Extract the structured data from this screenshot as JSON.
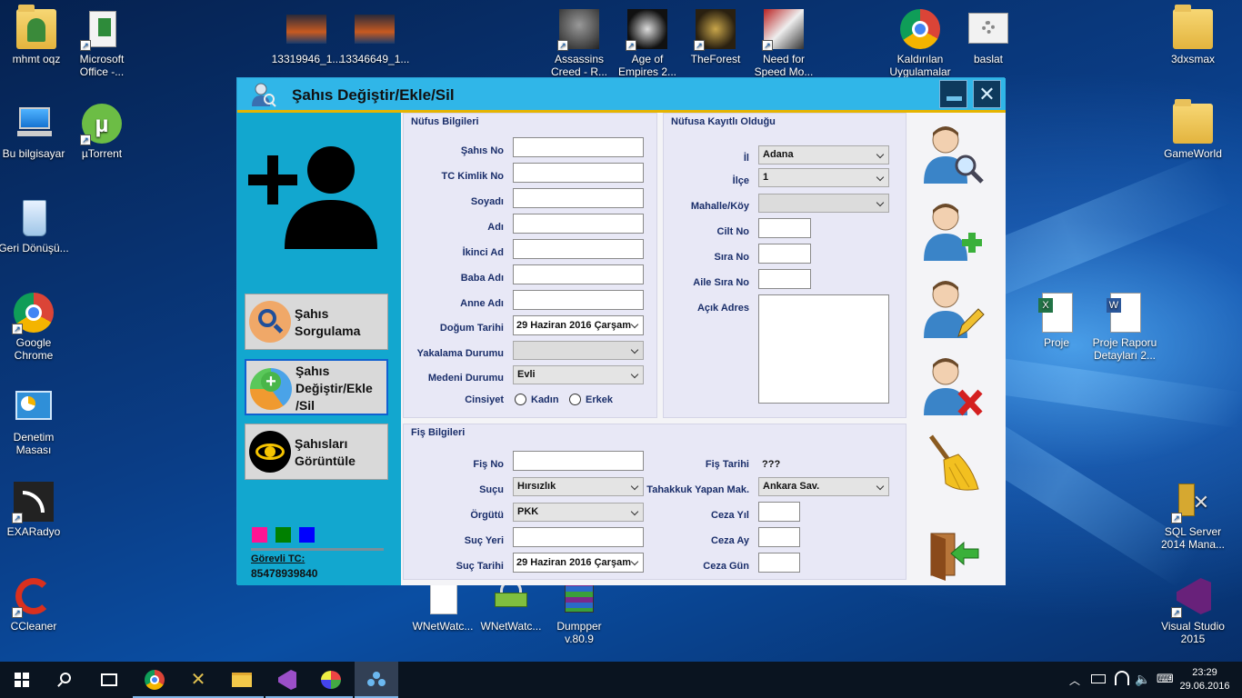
{
  "desktop": {
    "icons": [
      {
        "label": "mhmt oqz",
        "icon": "user-folder-icon"
      },
      {
        "label": "Microsoft Office -...",
        "icon": "office-icon"
      },
      {
        "label": "13319946_1...",
        "icon": "photo-thumbnail-icon"
      },
      {
        "label": "13346649_1...",
        "icon": "photo-thumbnail-icon"
      },
      {
        "label": "Assassins Creed - R...",
        "icon": "game-icon"
      },
      {
        "label": "Age of Empires 2...",
        "icon": "game-icon"
      },
      {
        "label": "TheForest",
        "icon": "game-icon"
      },
      {
        "label": "Need for Speed Mo...",
        "icon": "game-icon"
      },
      {
        "label": "Kaldırılan Uygulamalar",
        "icon": "chrome-icon"
      },
      {
        "label": "baslat",
        "icon": "settings-app-icon"
      },
      {
        "label": "3dxsmax",
        "icon": "folder-icon"
      },
      {
        "label": "Bu bilgisayar",
        "icon": "computer-icon"
      },
      {
        "label": "µTorrent",
        "icon": "utorrent-icon"
      },
      {
        "label": "GameWorld",
        "icon": "folder-icon"
      },
      {
        "label": "Geri Dönüşü...",
        "icon": "recycle-bin-icon"
      },
      {
        "label": "Google Chrome",
        "icon": "chrome-icon"
      },
      {
        "label": "Proje",
        "icon": "excel-icon"
      },
      {
        "label": "Proje Raporu Detayları 2...",
        "icon": "word-icon"
      },
      {
        "label": "Denetim Masası",
        "icon": "control-panel-icon"
      },
      {
        "label": "EXARadyo",
        "icon": "radio-icon"
      },
      {
        "label": "SQL Server 2014 Mana...",
        "icon": "sql-server-icon"
      },
      {
        "label": "CCleaner",
        "icon": "ccleaner-icon"
      },
      {
        "label": "WNetWatc...",
        "icon": "file-icon"
      },
      {
        "label": "WNetWatc...",
        "icon": "network-icon"
      },
      {
        "label": "Dumpper v.80.9",
        "icon": "archive-icon"
      },
      {
        "label": "Visual Studio 2015",
        "icon": "visual-studio-icon"
      }
    ]
  },
  "window": {
    "title": "Şahıs Değiştir/Ekle/Sil",
    "minimize_icon": "minimize-icon",
    "close_icon": "close-icon"
  },
  "sidebar": {
    "avatar_icon": "add-user-icon",
    "buttons": [
      {
        "label_line1": "Şahıs",
        "label_line2": "Sorgulama",
        "label_line3": "",
        "icon": "search-icon"
      },
      {
        "label_line1": "Şahıs",
        "label_line2": "Değiştir/Ekle",
        "label_line3": "/Sil",
        "icon": "add-edit-icon"
      },
      {
        "label_line1": "Şahısları",
        "label_line2": "Görüntüle",
        "label_line3": "",
        "icon": "eye-icon"
      }
    ],
    "color_swatches": [
      "#ff1493",
      "#008000",
      "#0000ff"
    ],
    "officer_label": "Görevli TC:",
    "officer_tc": "85478939840"
  },
  "nufus": {
    "title": "Nüfus Bilgileri",
    "labels": {
      "sahis_no": "Şahıs No",
      "tc": "TC Kimlik No",
      "soyadi": "Soyadı",
      "adi": "Adı",
      "ikinci_ad": "İkinci Ad",
      "baba_adi": "Baba Adı",
      "anne_adi": "Anne Adı",
      "dogum_tarihi": "Doğum Tarihi",
      "yakalama": "Yakalama Durumu",
      "medeni": "Medeni Durumu",
      "cinsiyet": "Cinsiyet"
    },
    "values": {
      "sahis_no": "",
      "tc": "",
      "soyadi": "",
      "adi": "",
      "ikinci_ad": "",
      "baba_adi": "",
      "anne_adi": "",
      "dogum_tarihi": "29  Haziran  2016 Çarşam",
      "yakalama": "",
      "medeni": "Evli"
    },
    "gender_options": [
      "Kadın",
      "Erkek"
    ]
  },
  "kayit": {
    "title": "Nüfusa Kayıtlı Olduğu",
    "labels": {
      "il": "İl",
      "ilce": "İlçe",
      "mahalle": "Mahalle/Köy",
      "cilt_no": "Cilt No",
      "sira_no": "Sıra No",
      "aile_sira_no": "Aile Sıra No",
      "acik_adres": "Açık Adres"
    },
    "values": {
      "il": "Adana",
      "ilce": "1",
      "mahalle": "",
      "cilt_no": "",
      "sira_no": "",
      "aile_sira_no": "",
      "acik_adres": ""
    }
  },
  "fis": {
    "title": "Fiş Bilgileri",
    "labels": {
      "fis_no": "Fiş No",
      "sucu": "Suçu",
      "orgutu": "Örgütü",
      "suc_yeri": "Suç Yeri",
      "suc_tarihi": "Suç Tarihi",
      "fis_tarihi": "Fiş Tarihi",
      "tahakkuk": "Tahakkuk Yapan Mak.",
      "ceza_yil": "Ceza Yıl",
      "ceza_ay": "Ceza Ay",
      "ceza_gun": "Ceza Gün"
    },
    "values": {
      "fis_no": "",
      "sucu": "Hırsızlık",
      "orgutu": "PKK",
      "suc_yeri": "",
      "suc_tarihi": "29  Haziran  2016 Çarşam",
      "fis_tarihi": "???",
      "tahakkuk": "Ankara Sav.",
      "ceza_yil": "",
      "ceza_ay": "",
      "ceza_gun": ""
    }
  },
  "actions": [
    {
      "name": "search-person-button",
      "icon": "person-search-icon"
    },
    {
      "name": "add-person-button",
      "icon": "person-add-icon"
    },
    {
      "name": "edit-person-button",
      "icon": "person-edit-icon"
    },
    {
      "name": "delete-person-button",
      "icon": "person-delete-icon"
    },
    {
      "name": "clear-button",
      "icon": "broom-icon"
    },
    {
      "name": "exit-button",
      "icon": "exit-door-icon"
    }
  ],
  "taskbar": {
    "time": "23:29",
    "date": "29.06.2016",
    "items": [
      "start-icon",
      "search-icon",
      "task-view-icon",
      "chrome-icon",
      "tools-icon",
      "file-explorer-icon",
      "visual-studio-icon",
      "paint-icon",
      "app-icon"
    ]
  }
}
